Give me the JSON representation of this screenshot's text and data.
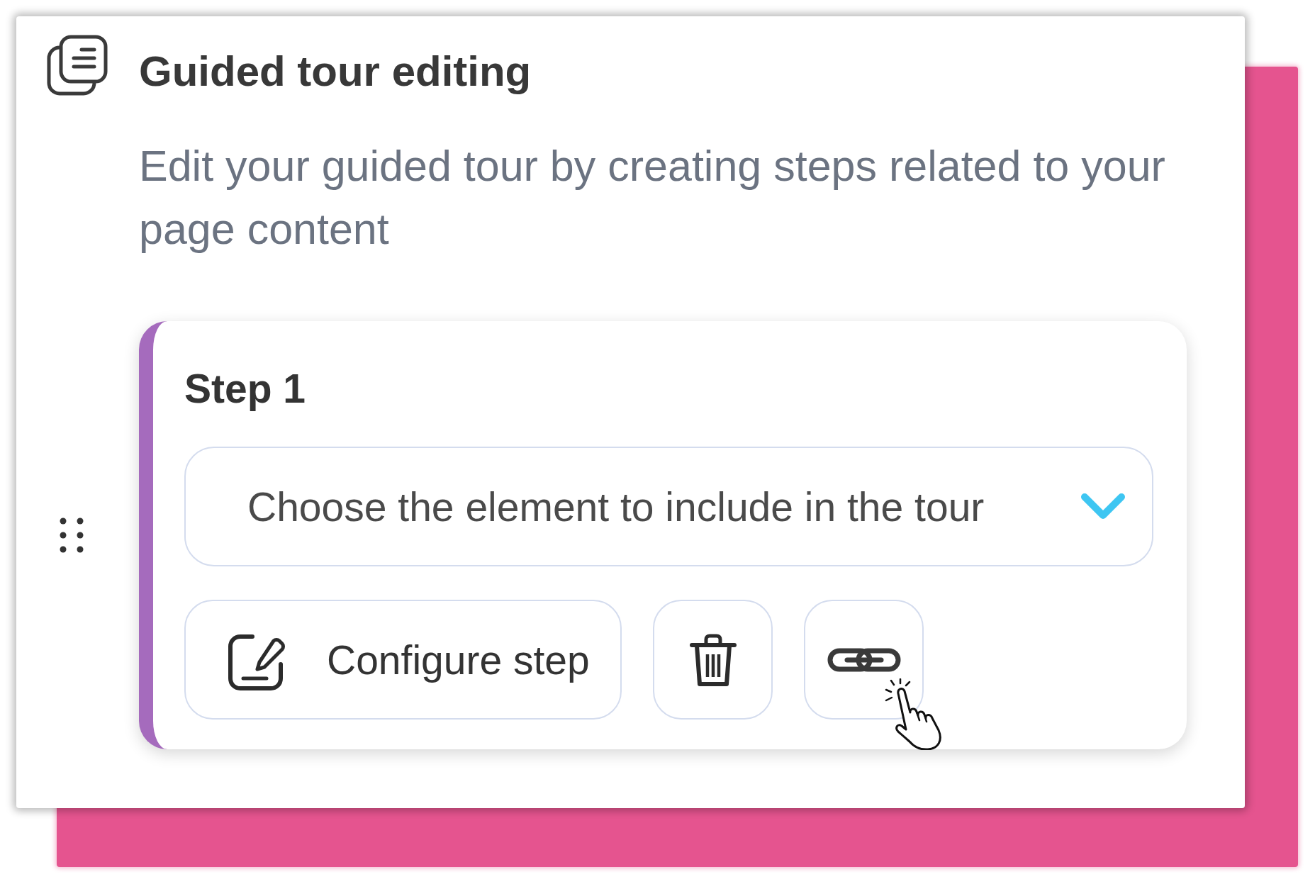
{
  "panel": {
    "title": "Guided tour editing",
    "description": "Edit your guided tour by creating steps related to your page content"
  },
  "steps": [
    {
      "title": "Step 1",
      "element_select": {
        "placeholder": "Choose the element to include in the tour"
      },
      "actions": [
        {
          "kind": "configure",
          "label": "Configure step",
          "hovered": false
        },
        {
          "kind": "delete",
          "hovered": false
        },
        {
          "kind": "link",
          "hovered": true
        }
      ]
    }
  ]
}
